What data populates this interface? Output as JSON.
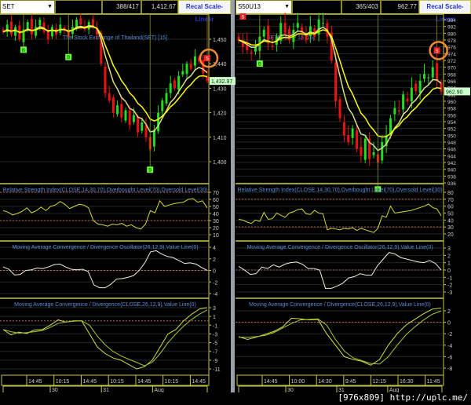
{
  "left": {
    "header": {
      "symbol": "SET",
      "blank": "",
      "bar_count": "388/417",
      "last_value": "1,412.67",
      "recal_label": "Recal Scale-Linear"
    },
    "price_tag": "1,432.97"
  },
  "right": {
    "header": {
      "symbol": "S50U13",
      "blank": "",
      "bar_count": "365/403",
      "last_value": "962.77",
      "recal_label": "Recal Scale-Linear"
    },
    "price_tag": "962.90"
  },
  "watermark": "[976x809] http://uplc.me/",
  "colors": {
    "up": "#22dd22",
    "down": "#ee1111",
    "ma1": "#ffff00",
    "ma2": "#dddd88",
    "axis": "#c8c840",
    "ref": "#c06060",
    "title": "#5a8ad8"
  },
  "chart_data": [
    {
      "type": "candlestick",
      "side": "left",
      "title": "The Stock Exchange of Thailand(SET) [15]",
      "ylim": [
        1395,
        1462
      ],
      "yticks": [
        "1,400",
        "1,410",
        "1,420",
        "1,430",
        "1,440",
        "1,450"
      ],
      "ytick_values": [
        1400,
        1410,
        1420,
        1430,
        1440,
        1450
      ],
      "close": [
        1453,
        1456,
        1452,
        1455,
        1450,
        1454,
        1457,
        1452,
        1455,
        1458,
        1453,
        1450,
        1455,
        1452,
        1456,
        1454,
        1451,
        1455,
        1458,
        1456,
        1454,
        1457,
        1455,
        1452,
        1440,
        1428,
        1425,
        1420,
        1423,
        1418,
        1421,
        1415,
        1419,
        1412,
        1416,
        1410,
        1405,
        1413,
        1420,
        1425,
        1428,
        1432,
        1430,
        1435,
        1437,
        1440,
        1438,
        1443,
        1441,
        1436,
        1432.97
      ],
      "signals": [
        {
          "label": "B",
          "index": 5
        },
        {
          "label": "B",
          "index": 16
        },
        {
          "label": "B",
          "index": 36
        },
        {
          "label": "S",
          "index": 50
        }
      ]
    },
    {
      "type": "line",
      "side": "left",
      "title": "Relative Strength Index(CLOSE,14,30,70),Overbought Level(70),Oversold Level(30)",
      "yticks": [
        "10",
        "20",
        "30",
        "40",
        "50",
        "60",
        "70"
      ],
      "ytick_values": [
        10,
        20,
        30,
        40,
        50,
        60,
        70
      ],
      "ref": [
        30,
        70
      ],
      "series": [
        [
          44,
          42,
          38,
          40,
          43,
          48,
          41,
          44,
          49,
          44,
          50,
          52,
          57,
          53,
          47,
          50,
          53,
          52,
          48,
          30,
          25,
          24,
          22,
          25,
          24,
          26,
          22,
          24,
          20,
          18,
          25,
          44,
          41,
          58,
          50,
          52,
          54,
          55,
          56,
          60,
          61,
          56,
          58,
          48
        ]
      ]
    },
    {
      "type": "line",
      "side": "left",
      "title": "Moving Average Convergence / Divergence Oscillator(26,12,9),Value Line(0)",
      "yticks": [
        "-4",
        "-2",
        "0",
        "2",
        "4"
      ],
      "ytick_values": [
        -4,
        -2,
        0,
        2,
        4
      ],
      "ref": [
        0
      ],
      "series": [
        [
          0.6,
          0.2,
          -0.8,
          -0.7,
          0,
          0.1,
          0.4,
          0.3,
          0.6,
          1,
          1.1,
          0.6,
          0.2,
          0.1,
          0.2,
          -0.2,
          -2.5,
          -3,
          -3,
          -2.4,
          -1.5,
          -1.4,
          -1.2,
          -0.9,
          0,
          1.3,
          3.2,
          3.4,
          2.8,
          2.4,
          2.2,
          1.7,
          1.2,
          1.3,
          1.1,
          0.5,
          0
        ]
      ]
    },
    {
      "type": "line",
      "side": "left",
      "title": "Moving Average Convergence / Divergence(CLOSE,26,12,9),Value Line(0)",
      "yticks": [
        "-11",
        "-9",
        "-7",
        "-5",
        "-3",
        "-1",
        "1",
        "3"
      ],
      "ytick_values": [
        -11,
        -9,
        -7,
        -5,
        -3,
        -1,
        1,
        3
      ],
      "ref": [
        0
      ],
      "series": [
        [
          -2,
          -3.2,
          -2.6,
          -2.9,
          -2.1,
          -2,
          -1,
          0.2,
          -0.3,
          0,
          0,
          -3,
          -6,
          -7.5,
          -8.5,
          -9,
          -10,
          -11,
          -10.5,
          -9,
          -6,
          -3,
          -2,
          0,
          1.5,
          2.7,
          3
        ],
        [
          -2,
          -2.5,
          -2.8,
          -2.7,
          -2.5,
          -2.2,
          -1.5,
          -0.6,
          -0.3,
          -0.1,
          0,
          -1,
          -3.5,
          -5.5,
          -7,
          -8,
          -8.8,
          -9.5,
          -10.3,
          -9.5,
          -7.5,
          -5,
          -3,
          -1.2,
          0.3,
          1.5,
          2.5
        ]
      ]
    },
    {
      "type": "candlestick",
      "side": "right",
      "title": "SET50 SEP 13   [15]",
      "ylim": [
        935,
        986
      ],
      "yticks": [
        "936",
        "938",
        "940",
        "942",
        "944",
        "946",
        "948",
        "950",
        "952",
        "954",
        "956",
        "958",
        "960",
        "962",
        "964",
        "966",
        "968",
        "970",
        "972",
        "974",
        "976",
        "978",
        "980",
        "982",
        "984"
      ],
      "ytick_values": [
        936,
        938,
        940,
        942,
        944,
        946,
        948,
        950,
        952,
        954,
        956,
        958,
        960,
        962,
        964,
        966,
        968,
        970,
        972,
        974,
        976,
        978,
        980,
        982,
        984
      ],
      "close": [
        978,
        976,
        975,
        974,
        976,
        979,
        981,
        977,
        976,
        979,
        983,
        980,
        978,
        981,
        983,
        980,
        978,
        982,
        979,
        984,
        983,
        979,
        972,
        960,
        955,
        950,
        948,
        952,
        946,
        944,
        949,
        943,
        945,
        942,
        948,
        950,
        955,
        958,
        957,
        962,
        960,
        964,
        963,
        966,
        968,
        967,
        970,
        966,
        962.9
      ],
      "signals": [
        {
          "label": "S",
          "index": 1
        },
        {
          "label": "B",
          "index": 5
        },
        {
          "label": "B",
          "index": 33
        },
        {
          "label": "S",
          "index": 47
        }
      ]
    },
    {
      "type": "line",
      "side": "right",
      "title": "Relative Strength Index(CLOSE,14,30,70),Overbought Level(70),Oversold Level(30)",
      "yticks": [
        "20",
        "30",
        "40",
        "50",
        "60",
        "70",
        "80"
      ],
      "ytick_values": [
        20,
        30,
        40,
        50,
        60,
        70,
        80
      ],
      "ref": [
        30,
        70
      ],
      "series": [
        [
          41,
          40,
          37,
          35,
          40,
          38,
          51,
          41,
          42,
          50,
          47,
          44,
          50,
          52,
          55,
          56,
          49,
          48,
          54,
          50,
          49,
          26,
          28,
          27,
          26,
          28,
          27,
          29,
          25,
          28,
          26,
          24,
          22,
          28,
          46,
          44,
          60,
          50,
          51,
          52,
          53,
          54,
          56,
          58,
          60,
          63,
          58,
          56,
          46
        ]
      ]
    },
    {
      "type": "line",
      "side": "right",
      "title": "Moving Average Convergence / Divergence Oscillator(26,12,9),Value Line(0)",
      "yticks": [
        "-3",
        "-2",
        "-1",
        "0",
        "1",
        "2",
        "3"
      ],
      "ytick_values": [
        -3,
        -2,
        -1,
        0,
        1,
        2,
        3
      ],
      "ref": [
        0
      ],
      "series": [
        [
          0.5,
          0,
          -0.6,
          -0.5,
          0.4,
          0.2,
          0.7,
          0.4,
          0.8,
          1,
          1.1,
          0.8,
          0.2,
          0.2,
          0,
          -2.5,
          -2.5,
          -2.2,
          -1.8,
          -1.1,
          -0.9,
          -0.5,
          -0.7,
          -0.7,
          0.6,
          1.5,
          2.4,
          2.2,
          1.7,
          1.5,
          1.3,
          1.1,
          1,
          1.3,
          0.9,
          0
        ]
      ]
    },
    {
      "type": "line",
      "side": "right",
      "title": "Moving Average Convergence / Divergence(CLOSE,26,12,9),Value Line(0)",
      "yticks": [
        "-8",
        "-6",
        "-4",
        "-2",
        "0",
        "2"
      ],
      "ytick_values": [
        -8,
        -6,
        -4,
        -2,
        0,
        2
      ],
      "ref": [
        0
      ],
      "series": [
        [
          -2.5,
          -3,
          -2.6,
          -2.1,
          -1.6,
          -0.8,
          0.7,
          0.6,
          0.4,
          0.5,
          -2,
          -4,
          -6,
          -6.5,
          -6.8,
          -7.5,
          -6.5,
          -4,
          -2,
          -0.5,
          0.5,
          1.5,
          2.3,
          2.5
        ],
        [
          -2.6,
          -2.6,
          -2.5,
          -2.3,
          -1.8,
          -1,
          -0.2,
          0.4,
          0.5,
          0.6,
          -0.5,
          -3,
          -5,
          -6.2,
          -6.7,
          -7.2,
          -7.3,
          -6,
          -4,
          -2.2,
          -0.8,
          0.4,
          1.4,
          2
        ]
      ]
    },
    {
      "type": "time_axis",
      "side": "left",
      "times": [
        "14:45",
        "10:15",
        "14:45",
        "10:15",
        "14:45",
        "10:15",
        "14:45"
      ],
      "dates": [
        "30",
        "31",
        "Aug"
      ]
    },
    {
      "type": "time_axis",
      "side": "right",
      "times": [
        "14:45",
        "10:00",
        "14:30",
        "9:45",
        "12:15",
        "16:30",
        "11:45"
      ],
      "dates": [
        "30",
        "31",
        "Aug"
      ]
    }
  ]
}
